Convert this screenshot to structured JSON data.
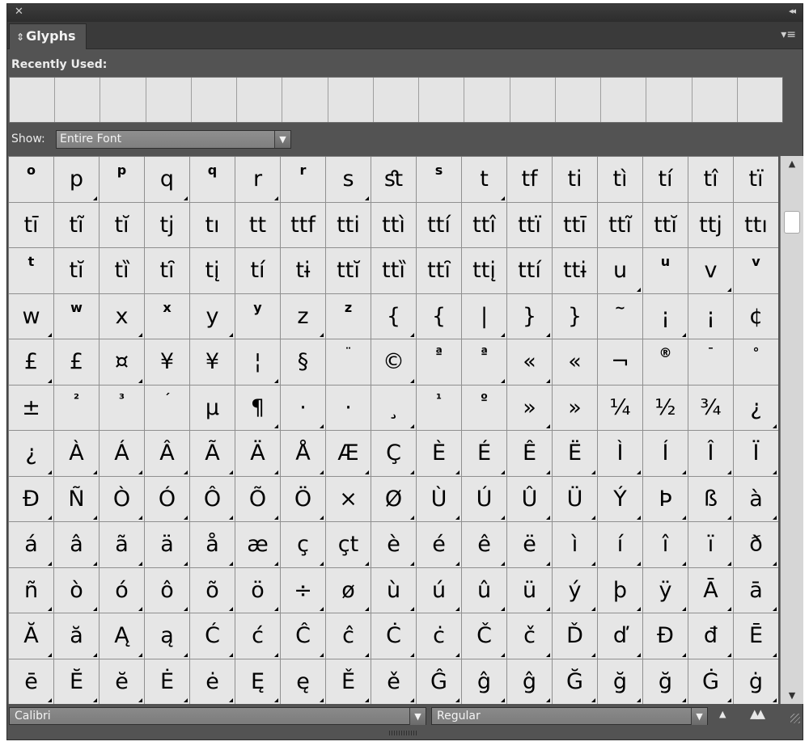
{
  "panel": {
    "close_glyph": "✕",
    "collapse_glyph": "◂◂",
    "menu_glyph": "▾≡",
    "tab_arrows": "⇕",
    "title": "Glyphs"
  },
  "recently_used": {
    "label": "Recently Used:",
    "cells": [
      "",
      "",
      "",
      "",
      "",
      "",
      "",
      "",
      "",
      "",
      "",
      "",
      "",
      "",
      "",
      "",
      ""
    ]
  },
  "show": {
    "label": "Show:",
    "value": "Entire Font"
  },
  "glyph_rows": [
    [
      "o",
      "p",
      "p",
      "q",
      "q",
      "r",
      "r",
      "s",
      "ﬆ",
      "s",
      "t",
      "tf",
      "ti",
      "tì",
      "tí",
      "tî",
      "tï"
    ],
    [
      "tī",
      "tĩ",
      "tĭ",
      "tj",
      "tı",
      "tt",
      "ttf",
      "tti",
      "ttì",
      "ttí",
      "ttî",
      "ttï",
      "ttī",
      "ttĩ",
      "ttĭ",
      "ttj",
      "ttı"
    ],
    [
      "t",
      "tĭ",
      "tȉ",
      "tȋ",
      "tį",
      "tí",
      "tɨ",
      "ttĭ",
      "ttȉ",
      "ttȋ",
      "ttį",
      "ttí",
      "ttɨ",
      "u",
      "u",
      "v",
      "v"
    ],
    [
      "w",
      "w",
      "x",
      "x",
      "y",
      "y",
      "z",
      "z",
      "{",
      "{",
      "|",
      "}",
      "}",
      "~",
      "¡",
      "¡",
      "¢"
    ],
    [
      "£",
      "£",
      "¤",
      "¥",
      "¥",
      "¦",
      "§",
      "¨",
      "©",
      "ª",
      "ª",
      "«",
      "«",
      "¬",
      "®",
      "¯",
      "°"
    ],
    [
      "±",
      "²",
      "³",
      "´",
      "µ",
      "¶",
      "·",
      "·",
      "¸",
      "¹",
      "º",
      "»",
      "»",
      "¼",
      "½",
      "¾",
      "¿"
    ],
    [
      "¿",
      "À",
      "Á",
      "Â",
      "Ã",
      "Ä",
      "Å",
      "Æ",
      "Ç",
      "È",
      "É",
      "Ê",
      "Ë",
      "Ì",
      "Í",
      "Î",
      "Ï"
    ],
    [
      "Ð",
      "Ñ",
      "Ò",
      "Ó",
      "Ô",
      "Õ",
      "Ö",
      "×",
      "Ø",
      "Ù",
      "Ú",
      "Û",
      "Ü",
      "Ý",
      "Þ",
      "ß",
      "à"
    ],
    [
      "á",
      "â",
      "ã",
      "ä",
      "å",
      "æ",
      "ç",
      "çt",
      "è",
      "é",
      "ê",
      "ë",
      "ì",
      "í",
      "î",
      "ï",
      "ð"
    ],
    [
      "ñ",
      "ò",
      "ó",
      "ô",
      "õ",
      "ö",
      "÷",
      "ø",
      "ù",
      "ú",
      "û",
      "ü",
      "ý",
      "þ",
      "ÿ",
      "Ā",
      "ā"
    ],
    [
      "Ă",
      "ă",
      "Ą",
      "ą",
      "Ć",
      "ć",
      "Ĉ",
      "ĉ",
      "Ċ",
      "ċ",
      "Č",
      "č",
      "Ď",
      "ď",
      "Đ",
      "đ",
      "Ē"
    ],
    [
      "ē",
      "Ĕ",
      "ĕ",
      "Ė",
      "ė",
      "Ę",
      "ę",
      "Ě",
      "ě",
      "Ĝ",
      "ĝ",
      "ĝ",
      "Ğ",
      "ğ",
      "ğ",
      "Ġ",
      "ġ"
    ]
  ],
  "superscript_cells": [
    [
      0,
      0
    ],
    [
      0,
      2
    ],
    [
      0,
      4
    ],
    [
      0,
      6
    ],
    [
      0,
      9
    ],
    [
      2,
      0
    ],
    [
      2,
      14
    ],
    [
      2,
      16
    ],
    [
      3,
      1
    ],
    [
      3,
      3
    ],
    [
      3,
      5
    ],
    [
      3,
      7
    ],
    [
      3,
      13
    ],
    [
      4,
      7
    ],
    [
      4,
      9
    ],
    [
      4,
      10
    ],
    [
      4,
      14
    ],
    [
      4,
      15
    ],
    [
      4,
      16
    ],
    [
      5,
      1
    ],
    [
      5,
      2
    ],
    [
      5,
      3
    ],
    [
      5,
      9
    ],
    [
      5,
      10
    ]
  ],
  "alternate_cells_note": "",
  "no_alt_cells": [
    [
      0,
      0
    ],
    [
      0,
      2
    ],
    [
      0,
      4
    ],
    [
      0,
      6
    ],
    [
      0,
      8
    ],
    [
      0,
      9
    ],
    [
      0,
      11
    ],
    [
      0,
      12
    ],
    [
      0,
      13
    ],
    [
      0,
      14
    ],
    [
      0,
      15
    ],
    [
      0,
      16
    ],
    [
      1,
      0
    ],
    [
      1,
      1
    ],
    [
      1,
      2
    ],
    [
      1,
      3
    ],
    [
      1,
      4
    ],
    [
      1,
      5
    ],
    [
      1,
      6
    ],
    [
      1,
      7
    ],
    [
      1,
      8
    ],
    [
      1,
      9
    ],
    [
      1,
      10
    ],
    [
      1,
      11
    ],
    [
      1,
      12
    ],
    [
      1,
      13
    ],
    [
      1,
      14
    ],
    [
      1,
      15
    ],
    [
      1,
      16
    ],
    [
      2,
      0
    ],
    [
      2,
      1
    ],
    [
      2,
      2
    ],
    [
      2,
      3
    ],
    [
      2,
      4
    ],
    [
      2,
      5
    ],
    [
      2,
      6
    ],
    [
      2,
      7
    ],
    [
      2,
      8
    ],
    [
      2,
      9
    ],
    [
      2,
      10
    ],
    [
      2,
      11
    ],
    [
      2,
      12
    ],
    [
      2,
      14
    ],
    [
      2,
      16
    ],
    [
      3,
      1
    ],
    [
      3,
      3
    ],
    [
      3,
      5
    ],
    [
      3,
      7
    ],
    [
      3,
      9
    ],
    [
      3,
      12
    ],
    [
      3,
      13
    ],
    [
      3,
      15
    ],
    [
      3,
      16
    ],
    [
      4,
      1
    ],
    [
      4,
      3
    ],
    [
      4,
      4
    ],
    [
      4,
      6
    ],
    [
      4,
      7
    ],
    [
      4,
      9
    ],
    [
      4,
      12
    ],
    [
      4,
      13
    ],
    [
      4,
      14
    ],
    [
      4,
      15
    ],
    [
      4,
      16
    ],
    [
      5,
      0
    ],
    [
      5,
      1
    ],
    [
      5,
      2
    ],
    [
      5,
      3
    ],
    [
      5,
      4
    ],
    [
      5,
      7
    ],
    [
      5,
      9
    ],
    [
      5,
      10
    ],
    [
      5,
      12
    ],
    [
      5,
      13
    ],
    [
      5,
      14
    ],
    [
      5,
      15
    ],
    [
      7,
      7
    ]
  ],
  "font": {
    "family_value": "Calibri",
    "style_value": "Regular"
  },
  "controls": {
    "dropdown_arrow": "▼",
    "scroll_up": "▲",
    "scroll_down": "▼",
    "zoom_out": "▲",
    "zoom_in": "▲▲"
  }
}
